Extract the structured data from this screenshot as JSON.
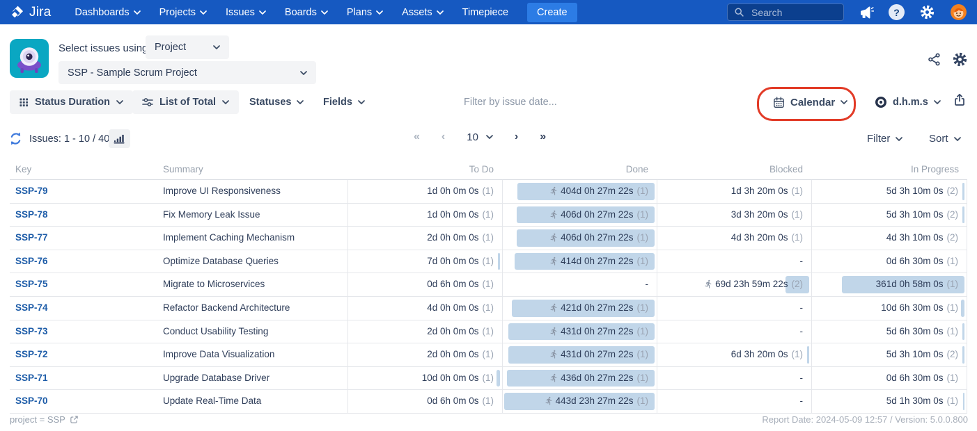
{
  "nav": {
    "brand": "Jira",
    "items": [
      {
        "label": "Dashboards",
        "chevron": true
      },
      {
        "label": "Projects",
        "chevron": true
      },
      {
        "label": "Issues",
        "chevron": true
      },
      {
        "label": "Boards",
        "chevron": true
      },
      {
        "label": "Plans",
        "chevron": true
      },
      {
        "label": "Assets",
        "chevron": true
      },
      {
        "label": "Timepiece",
        "chevron": false
      }
    ],
    "create_label": "Create",
    "search_placeholder": "Search"
  },
  "app_header": {
    "select_label": "Select issues using",
    "mode_value": "Project",
    "project_value": "SSP - Sample Scrum Project"
  },
  "toolbar": {
    "status_duration_label": "Status Duration",
    "list_of_total_label": "List of Total",
    "statuses_label": "Statuses",
    "fields_label": "Fields",
    "date_filter_placeholder": "Filter by issue date...",
    "calendar_label": "Calendar",
    "units_label": "d.h.m.s"
  },
  "list_bar": {
    "issues_label": "Issues: 1 - 10 / 40",
    "first_glyph": "«",
    "prev_glyph": "‹",
    "page_size": "10",
    "next_glyph": "›",
    "last_glyph": "»",
    "filter_label": "Filter",
    "sort_label": "Sort"
  },
  "table": {
    "columns": [
      "Key",
      "Summary",
      "To Do",
      "Done",
      "Blocked",
      "In Progress"
    ],
    "rows": [
      {
        "key": "SSP-79",
        "summary": "Improve UI Responsiveness",
        "todo": {
          "dur": "1d 0h 0m 0s",
          "count": "(1)"
        },
        "done": {
          "dur": "404d 0h 27m 22s",
          "count": "(1)",
          "bar": 0.91,
          "runner": true
        },
        "blocked": {
          "dur": "1d 3h 20m 0s",
          "count": "(1)"
        },
        "inprogress": {
          "dur": "5d 3h 10m 0s",
          "count": "(2)",
          "bar": 0.012
        }
      },
      {
        "key": "SSP-78",
        "summary": "Fix Memory Leak Issue",
        "todo": {
          "dur": "1d 0h 0m 0s",
          "count": "(1)"
        },
        "done": {
          "dur": "406d 0h 27m 22s",
          "count": "(1)",
          "bar": 0.915,
          "runner": true
        },
        "blocked": {
          "dur": "3d 3h 20m 0s",
          "count": "(1)"
        },
        "inprogress": {
          "dur": "5d 3h 10m 0s",
          "count": "(2)",
          "bar": 0.012
        }
      },
      {
        "key": "SSP-77",
        "summary": "Implement Caching Mechanism",
        "todo": {
          "dur": "2d 0h 0m 0s",
          "count": "(1)"
        },
        "done": {
          "dur": "406d 0h 27m 22s",
          "count": "(1)",
          "bar": 0.915,
          "runner": true
        },
        "blocked": {
          "dur": "4d 3h 20m 0s",
          "count": "(1)"
        },
        "inprogress": {
          "dur": "4d 3h 10m 0s",
          "count": "(2)"
        }
      },
      {
        "key": "SSP-76",
        "summary": "Optimize Database Queries",
        "todo": {
          "dur": "7d 0h 0m 0s",
          "count": "(1)",
          "bar": 0.016
        },
        "done": {
          "dur": "414d 0h 27m 22s",
          "count": "(1)",
          "bar": 0.932,
          "runner": true
        },
        "blocked": {
          "dur": "-"
        },
        "inprogress": {
          "dur": "0d 6h 30m 0s",
          "count": "(1)"
        }
      },
      {
        "key": "SSP-75",
        "summary": "Migrate to Microservices",
        "todo": {
          "dur": "0d 6h 0m 0s",
          "count": "(1)"
        },
        "done": {
          "dur": "-"
        },
        "blocked": {
          "dur": "69d 23h 59m 22s",
          "count": "(2)",
          "bar": 0.158,
          "runner": true
        },
        "inprogress": {
          "dur": "361d 0h 58m 0s",
          "count": "(1)",
          "bar": 0.813
        }
      },
      {
        "key": "SSP-74",
        "summary": "Refactor Backend Architecture",
        "todo": {
          "dur": "4d 0h 0m 0s",
          "count": "(1)"
        },
        "done": {
          "dur": "421d 0h 27m 22s",
          "count": "(1)",
          "bar": 0.948,
          "runner": true
        },
        "blocked": {
          "dur": "-"
        },
        "inprogress": {
          "dur": "10d 6h 30m 0s",
          "count": "(1)",
          "bar": 0.023
        }
      },
      {
        "key": "SSP-73",
        "summary": "Conduct Usability Testing",
        "todo": {
          "dur": "2d 0h 0m 0s",
          "count": "(1)"
        },
        "done": {
          "dur": "431d 0h 27m 22s",
          "count": "(1)",
          "bar": 0.971,
          "runner": true
        },
        "blocked": {
          "dur": "-"
        },
        "inprogress": {
          "dur": "5d 6h 30m 0s",
          "count": "(1)",
          "bar": 0.012
        }
      },
      {
        "key": "SSP-72",
        "summary": "Improve Data Visualization",
        "todo": {
          "dur": "2d 0h 0m 0s",
          "count": "(1)"
        },
        "done": {
          "dur": "431d 0h 27m 22s",
          "count": "(1)",
          "bar": 0.971,
          "runner": true
        },
        "blocked": {
          "dur": "6d 3h 20m 0s",
          "count": "(1)",
          "bar": 0.014
        },
        "inprogress": {
          "dur": "5d 3h 10m 0s",
          "count": "(2)",
          "bar": 0.012
        }
      },
      {
        "key": "SSP-71",
        "summary": "Upgrade Database Driver",
        "todo": {
          "dur": "10d 0h 0m 0s",
          "count": "(1)",
          "bar": 0.023
        },
        "done": {
          "dur": "436d 0h 27m 22s",
          "count": "(1)",
          "bar": 0.982,
          "runner": true
        },
        "blocked": {
          "dur": "-"
        },
        "inprogress": {
          "dur": "0d 6h 30m 0s",
          "count": "(1)"
        }
      },
      {
        "key": "SSP-70",
        "summary": "Update Real-Time Data",
        "todo": {
          "dur": "0d 6h 0m 0s",
          "count": "(1)"
        },
        "done": {
          "dur": "443d 23h 27m 22s",
          "count": "(1)",
          "bar": 1.0,
          "runner": true
        },
        "blocked": {
          "dur": "-"
        },
        "inprogress": {
          "dur": "5d 1h 30m 0s",
          "count": "(1)",
          "bar": 0.011
        }
      }
    ]
  },
  "footer": {
    "query_text": "project = SSP",
    "report_text": "Report Date: 2024-05-09 12:57 / Version: 5.0.0.800"
  },
  "icons": {
    "help_glyph": "?"
  },
  "colors": {
    "nav_bg": "#1659C1",
    "create_btn": "#2C7CE5",
    "issue_link": "#1D5CA8",
    "duration_bar": "#C1D6E9",
    "annotation_red": "#E23B27",
    "app_icon_teal": "#0AA7C2"
  }
}
